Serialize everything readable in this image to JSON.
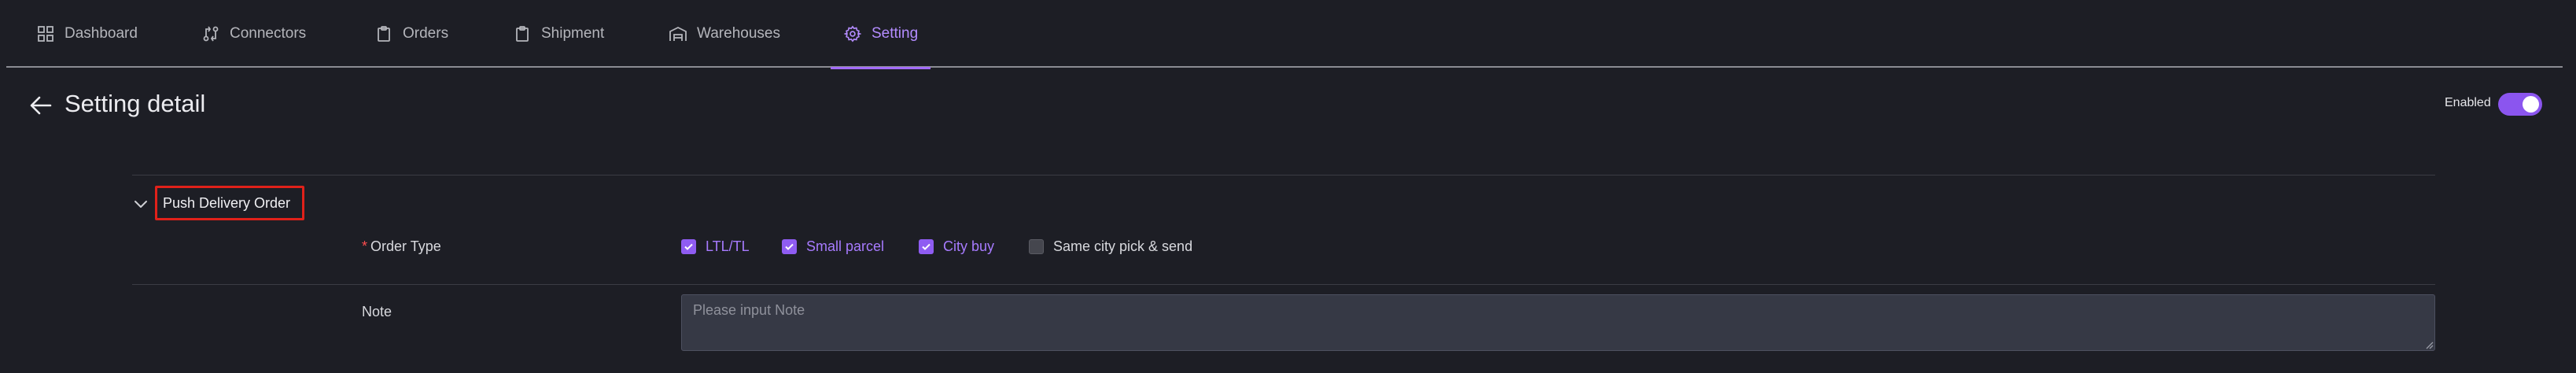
{
  "nav": {
    "tabs": [
      {
        "label": "Dashboard",
        "icon": "dashboard-grid-icon"
      },
      {
        "label": "Connectors",
        "icon": "connectors-icon"
      },
      {
        "label": "Orders",
        "icon": "orders-clipboard-icon"
      },
      {
        "label": "Shipment",
        "icon": "shipment-clipboard-icon"
      },
      {
        "label": "Warehouses",
        "icon": "warehouse-icon"
      },
      {
        "label": "Setting",
        "icon": "gear-icon",
        "active": true
      }
    ]
  },
  "header": {
    "title": "Setting detail",
    "enabled_label": "Enabled",
    "enabled": true
  },
  "section": {
    "title": "Push Delivery Order",
    "expanded": true
  },
  "order_type": {
    "label": "Order Type",
    "required_mark": "*",
    "options": [
      {
        "label": "LTL/TL",
        "checked": true
      },
      {
        "label": "Small parcel",
        "checked": true
      },
      {
        "label": "City buy",
        "checked": true
      },
      {
        "label": "Same city pick & send",
        "checked": false
      }
    ]
  },
  "note": {
    "label": "Note",
    "placeholder": "Please input Note",
    "value": ""
  },
  "colors": {
    "background": "#1d1e25",
    "accent": "#a26bff",
    "highlight_border": "#e0211a"
  }
}
